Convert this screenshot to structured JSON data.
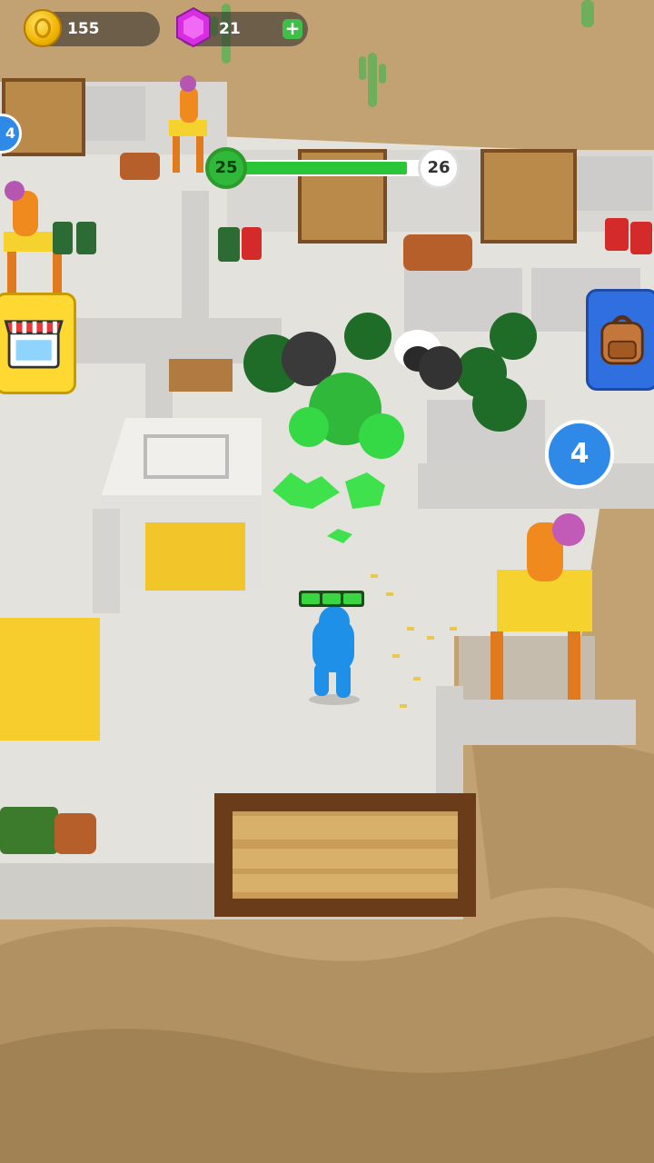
{
  "hud": {
    "coins": "155",
    "coin_icon": "coin-icon",
    "gems": "21",
    "gem_icon": "gem-icon",
    "add_gems_label": "+"
  },
  "progress": {
    "current_level": "25",
    "next_level": "26",
    "fill_fraction": 0.92
  },
  "side_buttons": {
    "shop_icon": "shop-icon",
    "backpack_icon": "backpack-icon"
  },
  "enemy_count": "4",
  "edge_marker": "4",
  "player": {
    "health_segments_filled": 3,
    "health_segments_total": 3
  },
  "colors": {
    "accent_green": "#2bc53a",
    "player_blue": "#1e90e8",
    "zombie_green": "#1f7a2c",
    "shop_yellow": "#ffd832",
    "backpack_blue": "#2f6fe0"
  }
}
